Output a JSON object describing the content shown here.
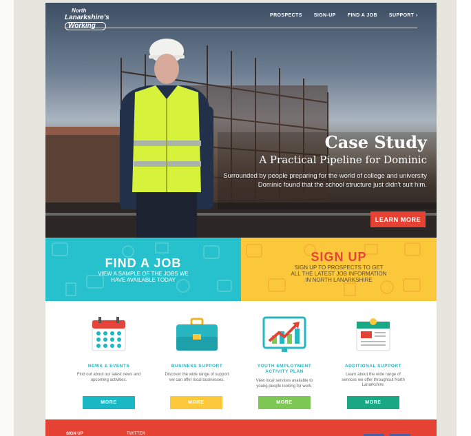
{
  "logo": {
    "line1": "North",
    "line2": "Lanarkshire's",
    "line3": "Working"
  },
  "nav": [
    "PROSPECTS",
    "SIGN-UP",
    "FIND A JOB",
    "SUPPORT ›"
  ],
  "hero": {
    "title": "Case Study",
    "subtitle": "A Practical Pipeline for Dominic",
    "body": "Surrounded by people preparing for the world of college and university Dominic found that the school structure just didn't suit him.",
    "button": "LEARN MORE"
  },
  "banners": {
    "find": {
      "title": "FIND A JOB",
      "text": "VIEW A SAMPLE OF THE JOBS WE HAVE AVAILABLE TODAY"
    },
    "sign": {
      "title": "SIGN UP",
      "text": "SIGN UP TO PROSPECTS TO GET ALL THE LATEST JOB INFORMATION IN NORTH LANARKSHIRE"
    }
  },
  "services": [
    {
      "title": "NEWS & EVENTS",
      "desc": "Find out about our latest news and upcoming activities.",
      "button": "MORE",
      "icon": "calendar-icon",
      "color": "#19b8c4"
    },
    {
      "title": "BUSINESS SUPPORT",
      "desc": "Discover the wide range of support we can offer local businesses.",
      "button": "MORE",
      "icon": "briefcase-icon",
      "color": "#fcc83b"
    },
    {
      "title": "YOUTH EMPLOYMENT ACTIVITY PLAN",
      "desc": "View local services available to young people looking for work.",
      "button": "MORE",
      "icon": "growth-chart-icon",
      "color": "#7dc855"
    },
    {
      "title": "ADDITIONAL SUPPORT",
      "desc": "Learn about the wide range of services we offer throughout North Lanarkshire.",
      "button": "MORE",
      "icon": "document-icon",
      "color": "#1aa783"
    }
  ],
  "footer": {
    "col1": "SIGN UP",
    "col2": "TWITTER"
  },
  "colors": {
    "teal": "#26c1cc",
    "yellow": "#fcc83b",
    "red": "#e54234",
    "green": "#7dc855",
    "dark_green": "#1aa783"
  }
}
